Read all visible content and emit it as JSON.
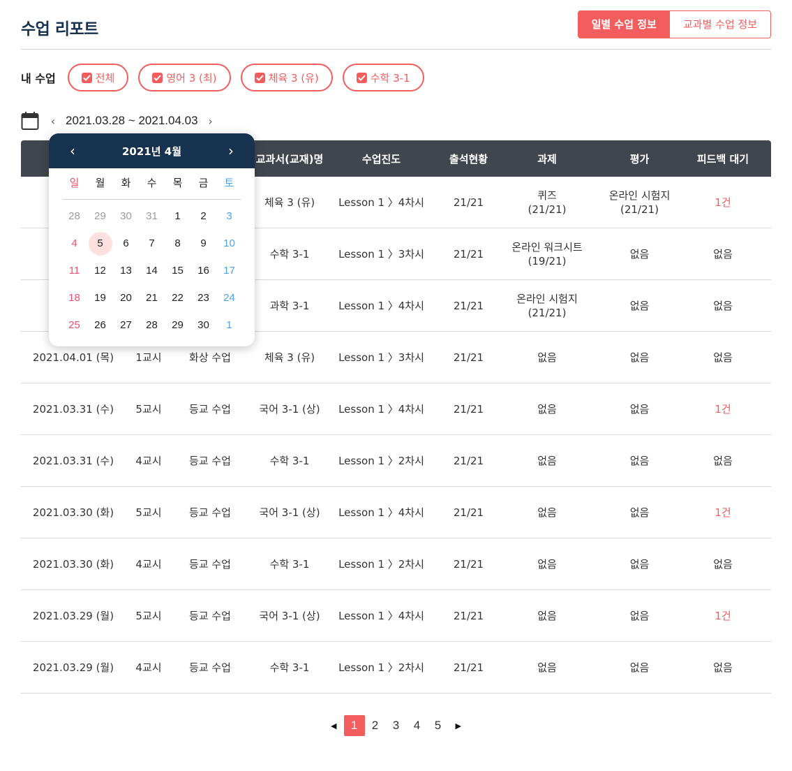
{
  "header": {
    "title": "수업 리포트",
    "toggle": [
      "일별 수업 정보",
      "교과별 수업 정보"
    ]
  },
  "filters": {
    "label": "내 수업",
    "chips": [
      "전체",
      "영어 3 (최)",
      "체육 3 (유)",
      "수학 3-1"
    ]
  },
  "date_nav": {
    "range": "2021.03.28 ~ 2021.04.03",
    "prev": "‹",
    "next": "›"
  },
  "calendar": {
    "month": "2021년 4월",
    "weekdays": [
      "일",
      "월",
      "화",
      "수",
      "목",
      "금",
      "토"
    ],
    "weeks": [
      [
        "28",
        "29",
        "30",
        "31",
        "1",
        "2",
        "3"
      ],
      [
        "4",
        "5",
        "6",
        "7",
        "8",
        "9",
        "10"
      ],
      [
        "11",
        "12",
        "13",
        "14",
        "15",
        "16",
        "17"
      ],
      [
        "18",
        "19",
        "20",
        "21",
        "22",
        "23",
        "24"
      ],
      [
        "25",
        "26",
        "27",
        "28",
        "29",
        "30",
        "1"
      ]
    ],
    "today": "5"
  },
  "table": {
    "headers": [
      "",
      "",
      "",
      "교과서(교재)명",
      "수업진도",
      "출석현황",
      "과제",
      "평가",
      "피드백 대기"
    ],
    "rows": [
      {
        "date": "",
        "period": "",
        "type": "",
        "book": "체육 3 (유)",
        "progress": "Lesson 1 〉4차시",
        "attendance": "21/21",
        "task": [
          "퀴즈",
          "(21/21)"
        ],
        "eval": [
          "온라인 시험지",
          "(21/21)"
        ],
        "feedback": "1건"
      },
      {
        "date": "",
        "period": "",
        "type": "",
        "book": "수학 3-1",
        "progress": "Lesson 1 〉3차시",
        "attendance": "21/21",
        "task": [
          "온라인 워크시트",
          "(19/21)"
        ],
        "eval": [
          "없음"
        ],
        "feedback": "없음"
      },
      {
        "date": "",
        "period": "",
        "type": "",
        "book": "과학 3-1",
        "progress": "Lesson 1 〉4차시",
        "attendance": "21/21",
        "task": [
          "온라인 시험지",
          "(21/21)"
        ],
        "eval": [
          "없음"
        ],
        "feedback": "없음"
      },
      {
        "date": "2021.04.01 (목)",
        "period": "1교시",
        "type": "화상 수업",
        "book": "체육 3 (유)",
        "progress": "Lesson 1 〉3차시",
        "attendance": "21/21",
        "task": [
          "없음"
        ],
        "eval": [
          "없음"
        ],
        "feedback": "없음"
      },
      {
        "date": "2021.03.31 (수)",
        "period": "5교시",
        "type": "등교 수업",
        "book": "국어 3-1 (상)",
        "progress": "Lesson 1 〉4차시",
        "attendance": "21/21",
        "task": [
          "없음"
        ],
        "eval": [
          "없음"
        ],
        "feedback": "1건"
      },
      {
        "date": "2021.03.31 (수)",
        "period": "4교시",
        "type": "등교 수업",
        "book": "수학 3-1",
        "progress": "Lesson 1 〉2차시",
        "attendance": "21/21",
        "task": [
          "없음"
        ],
        "eval": [
          "없음"
        ],
        "feedback": "없음"
      },
      {
        "date": "2021.03.30 (화)",
        "period": "5교시",
        "type": "등교 수업",
        "book": "국어 3-1 (상)",
        "progress": "Lesson 1 〉4차시",
        "attendance": "21/21",
        "task": [
          "없음"
        ],
        "eval": [
          "없음"
        ],
        "feedback": "1건"
      },
      {
        "date": "2021.03.30 (화)",
        "period": "4교시",
        "type": "등교 수업",
        "book": "수학 3-1",
        "progress": "Lesson 1 〉2차시",
        "attendance": "21/21",
        "task": [
          "없음"
        ],
        "eval": [
          "없음"
        ],
        "feedback": "없음"
      },
      {
        "date": "2021.03.29 (월)",
        "period": "5교시",
        "type": "등교 수업",
        "book": "국어 3-1 (상)",
        "progress": "Lesson 1 〉4차시",
        "attendance": "21/21",
        "task": [
          "없음"
        ],
        "eval": [
          "없음"
        ],
        "feedback": "1건"
      },
      {
        "date": "2021.03.29 (월)",
        "period": "4교시",
        "type": "등교 수업",
        "book": "수학 3-1",
        "progress": "Lesson 1 〉2차시",
        "attendance": "21/21",
        "task": [
          "없음"
        ],
        "eval": [
          "없음"
        ],
        "feedback": "없음"
      }
    ]
  },
  "pagination": {
    "pages": [
      "1",
      "2",
      "3",
      "4",
      "5"
    ],
    "current": "1",
    "prev": "◀",
    "next": "▶"
  },
  "colors": {
    "accent": "#f35d5d",
    "navy": "#16324f",
    "table_header": "#41454d",
    "sunday": "#ef4f6f",
    "saturday": "#4aa3e8"
  }
}
